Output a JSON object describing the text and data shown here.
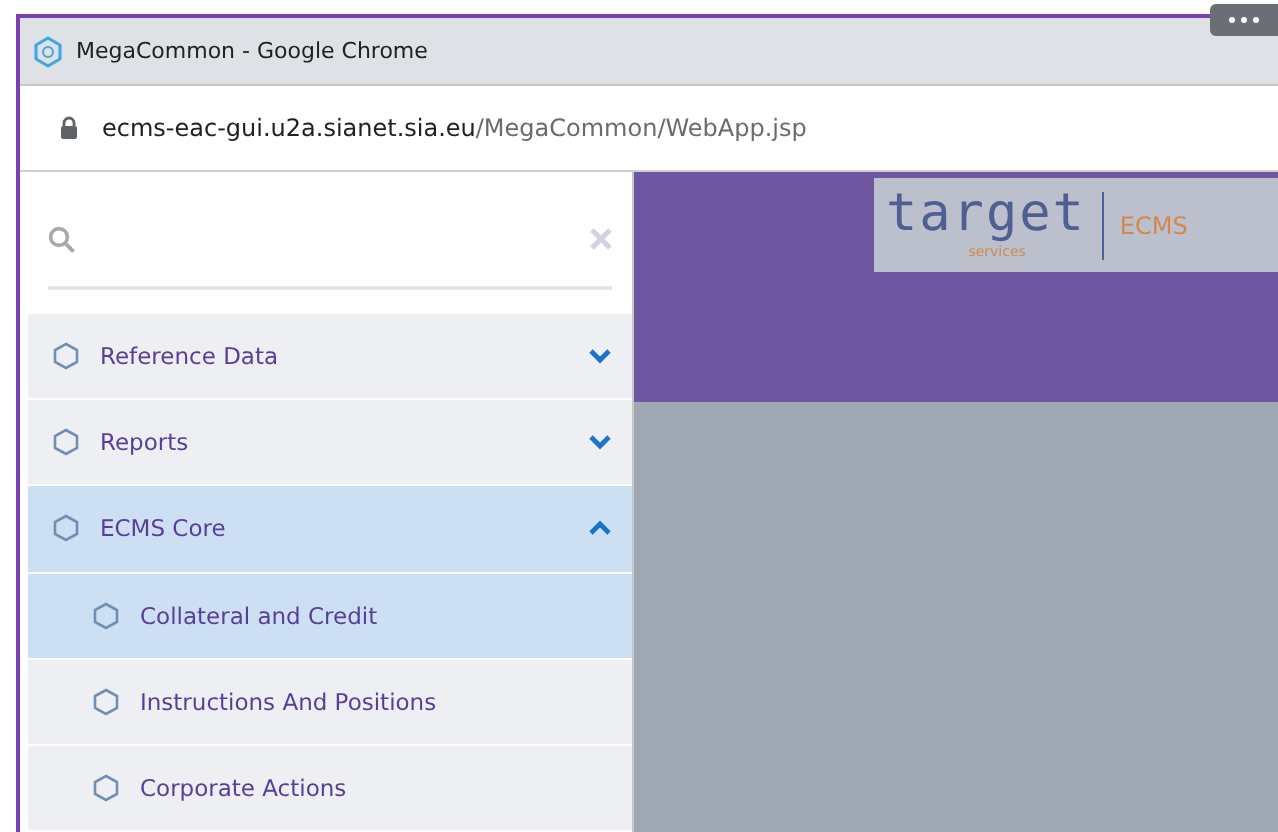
{
  "window": {
    "title": "MegaCommon - Google Chrome"
  },
  "address": {
    "host": "ecms-eac-gui.u2a.sianet.sia.eu",
    "path": "/MegaCommon/WebApp.jsp"
  },
  "logo": {
    "word": "target",
    "sub": "services",
    "product": "ECMS"
  },
  "menu": [
    {
      "label": "Reference Data",
      "expanded": false
    },
    {
      "label": "Reports",
      "expanded": false
    },
    {
      "label": "ECMS Core",
      "expanded": true,
      "children": [
        {
          "label": "Collateral and Credit",
          "selected": true
        },
        {
          "label": "Instructions And Positions",
          "selected": false
        },
        {
          "label": "Corporate Actions",
          "selected": false
        }
      ]
    }
  ]
}
